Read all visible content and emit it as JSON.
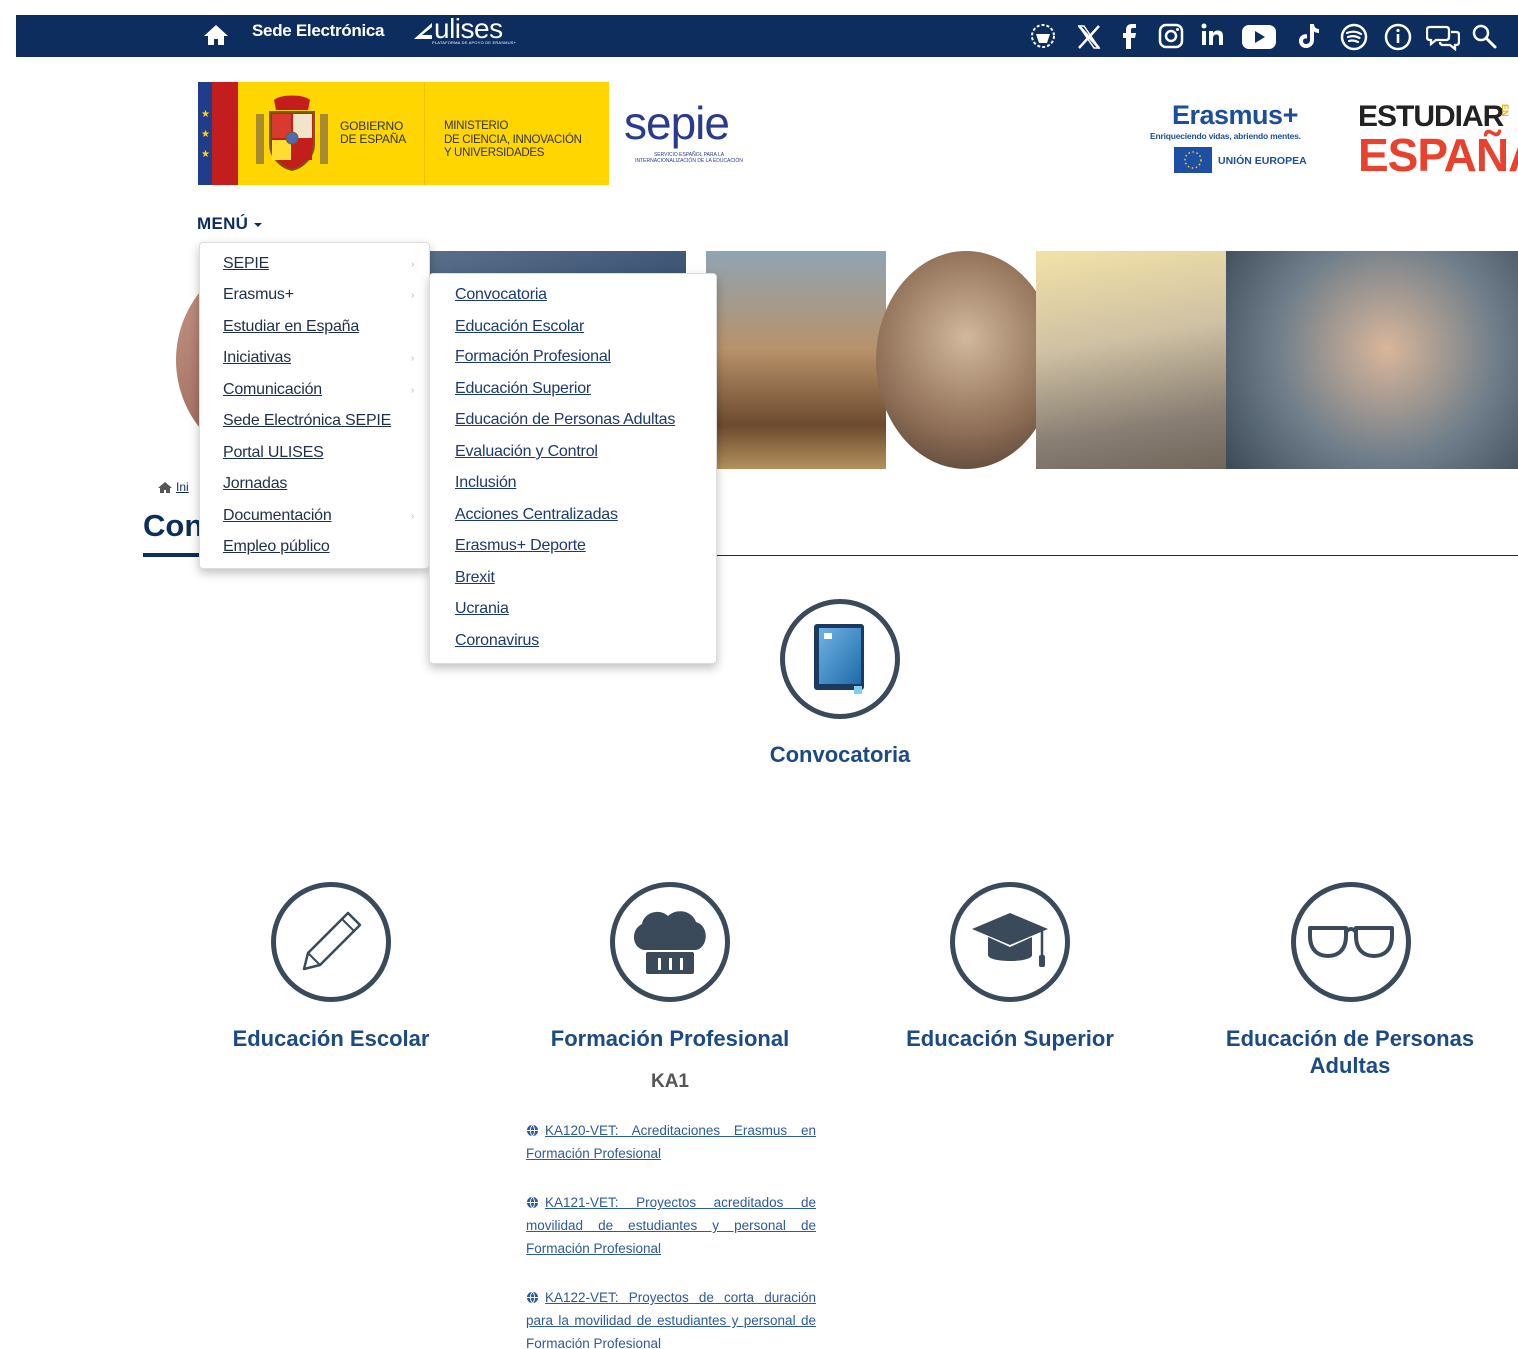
{
  "topbar": {
    "sede_label": "Sede Electrónica",
    "ulises_word": "ulises",
    "ulises_sub": "PLATAFORMA DE APOYO DE ERASMUS+",
    "social_icons": [
      "accessibility-icon",
      "x-icon",
      "facebook-icon",
      "instagram-icon",
      "linkedin-icon",
      "youtube-icon",
      "tiktok-icon",
      "spotify-icon",
      "info-icon",
      "chat-icon",
      "search-icon"
    ]
  },
  "logos": {
    "gov_line1": "GOBIERNO",
    "gov_line2": "DE ESPAÑA",
    "ministry_line1": "MINISTERIO",
    "ministry_line2": "DE CIENCIA, INNOVACIÓN",
    "ministry_line3": "Y UNIVERSIDADES",
    "sepie_word": "sepie",
    "sepie_sub": "SERVICIO ESPAÑOL PARA LA INTERNACIONALIZACIÓN DE LA EDUCACIÓN",
    "erasmus_title": "Erasmus+",
    "erasmus_tag": "Enriqueciendo vidas, abriendo mentes.",
    "erasmus_eu": "UNIÓN EUROPEA",
    "estudiar_line1": "ESTUDIAR",
    "estudiar_en": "EN",
    "estudiar_line2": "ESPAÑA"
  },
  "menu": {
    "label": "MENÚ",
    "items": [
      {
        "label": "SEPIE",
        "has_sub": true
      },
      {
        "label": "Erasmus+",
        "has_sub": true,
        "active": true
      },
      {
        "label": "Estudiar en España",
        "has_sub": false
      },
      {
        "label": "Iniciativas",
        "has_sub": true
      },
      {
        "label": "Comunicación",
        "has_sub": true
      },
      {
        "label": "Sede Electrónica SEPIE",
        "has_sub": false
      },
      {
        "label": "Portal ULISES",
        "has_sub": false
      },
      {
        "label": "Jornadas",
        "has_sub": false
      },
      {
        "label": "Documentación",
        "has_sub": true
      },
      {
        "label": "Empleo público",
        "has_sub": false
      }
    ],
    "submenu": [
      "Convocatoria",
      "Educación Escolar",
      "Formación Profesional",
      "Educación Superior",
      "Educación de Personas Adultas",
      "Evaluación y Control",
      "Inclusión",
      "Acciones Centralizadas",
      "Erasmus+ Deporte",
      "Brexit",
      "Ucrania",
      "Coronavirus"
    ]
  },
  "breadcrumb": {
    "home_text": "Ini"
  },
  "page": {
    "title_visible": "Con"
  },
  "categories": {
    "convocatoria": "Convocatoria",
    "escolar": "Educación Escolar",
    "fp": "Formación Profesional",
    "superior": "Educación Superior",
    "adultas_line1": "Educación de Personas",
    "adultas_line2": "Adultas"
  },
  "ka1": {
    "heading": "KA1",
    "links": [
      "KA120-VET: Acreditaciones Erasmus en Formación Profesional",
      "KA121-VET: Proyectos acreditados de movilidad de estudiantes y personal de Formación Profesional",
      "KA122-VET: Proyectos de corta duración para la movilidad de estudiantes y personal de Formación Profesional"
    ]
  },
  "colors": {
    "navy": "#0c2d5e",
    "link_blue": "#1c4a85",
    "circle_border": "#3a4a5a",
    "gov_yellow": "#ffd600"
  }
}
